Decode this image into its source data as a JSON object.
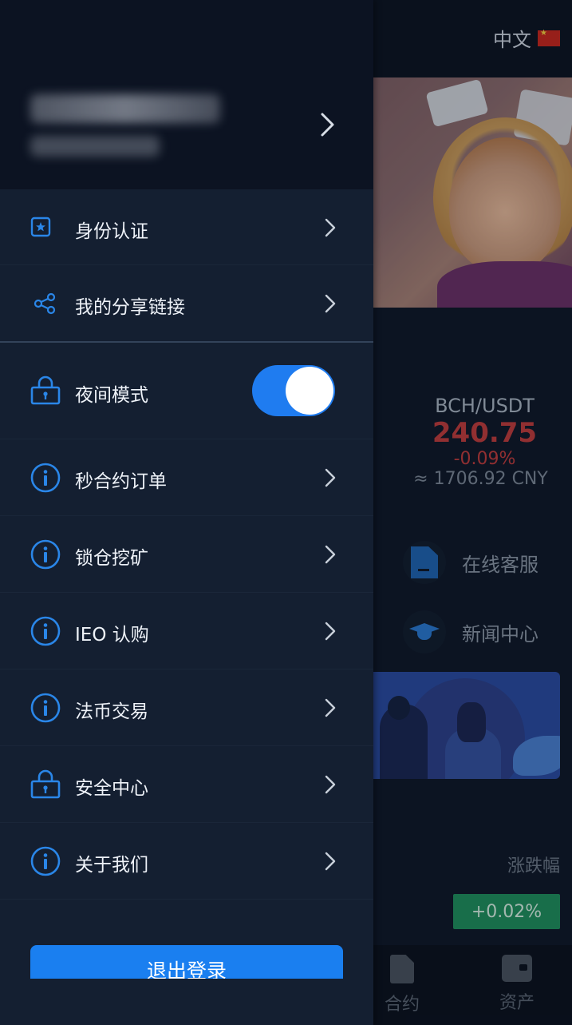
{
  "header": {
    "language_label": "中文"
  },
  "ticker": {
    "pair": "BCH/USDT",
    "price": "240.75",
    "change": "-0.09%",
    "cny": "≈ 1706.92 CNY"
  },
  "services": [
    {
      "label": "在线客服",
      "icon": "document-icon"
    },
    {
      "label": "新闻中心",
      "icon": "graduation-cap-icon"
    }
  ],
  "market": {
    "change_header": "涨跌幅",
    "change_value": "+0.02%"
  },
  "tabbar": [
    {
      "label": "合约",
      "icon": "document-icon"
    },
    {
      "label": "资产",
      "icon": "wallet-icon"
    }
  ],
  "drawer": {
    "menu": [
      {
        "label": "身份认证",
        "icon": "id-star-icon"
      },
      {
        "label": "我的分享链接",
        "icon": "share-icon"
      },
      {
        "label": "夜间模式",
        "icon": "lock-icon",
        "toggle": true,
        "toggle_on": true
      },
      {
        "label": "秒合约订单",
        "icon": "info-icon"
      },
      {
        "label": "锁仓挖矿",
        "icon": "info-icon"
      },
      {
        "label": "IEO 认购",
        "icon": "info-icon"
      },
      {
        "label": "法币交易",
        "icon": "info-icon"
      },
      {
        "label": "安全中心",
        "icon": "lock-icon"
      },
      {
        "label": "关于我们",
        "icon": "info-icon"
      }
    ],
    "logout_label": "退出登录"
  },
  "colors": {
    "accent": "#1f7cf0",
    "price_down": "#c13b3b",
    "badge_up": "#1f8f5c",
    "drawer_bg": "#141f31"
  }
}
